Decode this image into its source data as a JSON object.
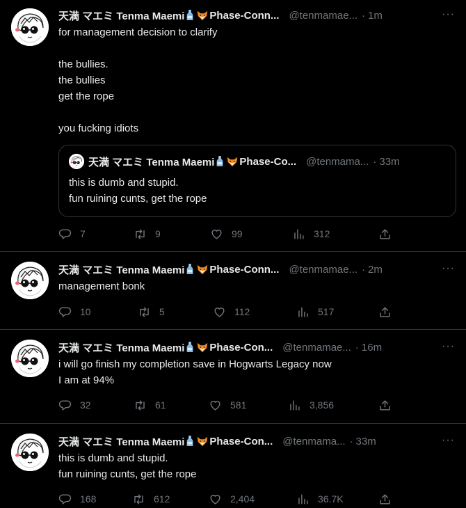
{
  "tweets": [
    {
      "name": "天満 マエミ Tenma Maemi",
      "name_suffix": "Phase-Conn...",
      "handle": "@tenmamae...",
      "time": "1m",
      "text": "for management decision to clarify\n\nthe bullies.\nthe bullies\nget the rope\n\nyou fucking idiots",
      "quote": {
        "name": "天満 マエミ Tenma Maemi",
        "name_suffix": "Phase-Co...",
        "handle": "@tenmama...",
        "time": "33m",
        "text": "this is dumb and stupid.\nfun ruining cunts, get the rope"
      },
      "replies": "7",
      "retweets": "9",
      "likes": "99",
      "views": "312"
    },
    {
      "name": "天満 マエミ Tenma Maemi",
      "name_suffix": "Phase-Conn...",
      "handle": "@tenmamae...",
      "time": "2m",
      "text": "management bonk",
      "replies": "10",
      "retweets": "5",
      "likes": "112",
      "views": "517"
    },
    {
      "name": "天満 マエミ Tenma Maemi",
      "name_suffix": "Phase-Con...",
      "handle": "@tenmamae...",
      "time": "16m",
      "text": "i will go finish my completion save  in Hogwarts Legacy now\nI am at 94%",
      "replies": "32",
      "retweets": "61",
      "likes": "581",
      "views": "3,856"
    },
    {
      "name": "天満 マエミ Tenma Maemi",
      "name_suffix": "Phase-Con...",
      "handle": "@tenmama...",
      "time": "33m",
      "text": "this is dumb and stupid.\nfun ruining cunts, get the rope",
      "replies": "168",
      "retweets": "612",
      "likes": "2,404",
      "views": "36.7K"
    }
  ],
  "icons": {
    "name_emojis": [
      "bottle-emoji",
      "fox-emoji"
    ],
    "more": "more-icon",
    "reply": "reply-icon",
    "retweet": "retweet-icon",
    "like": "heart-icon",
    "views": "views-icon",
    "share": "share-icon"
  },
  "colors": {
    "background": "#000000",
    "text": "#e7e9ea",
    "muted": "#71767b",
    "border": "#2f3336"
  }
}
